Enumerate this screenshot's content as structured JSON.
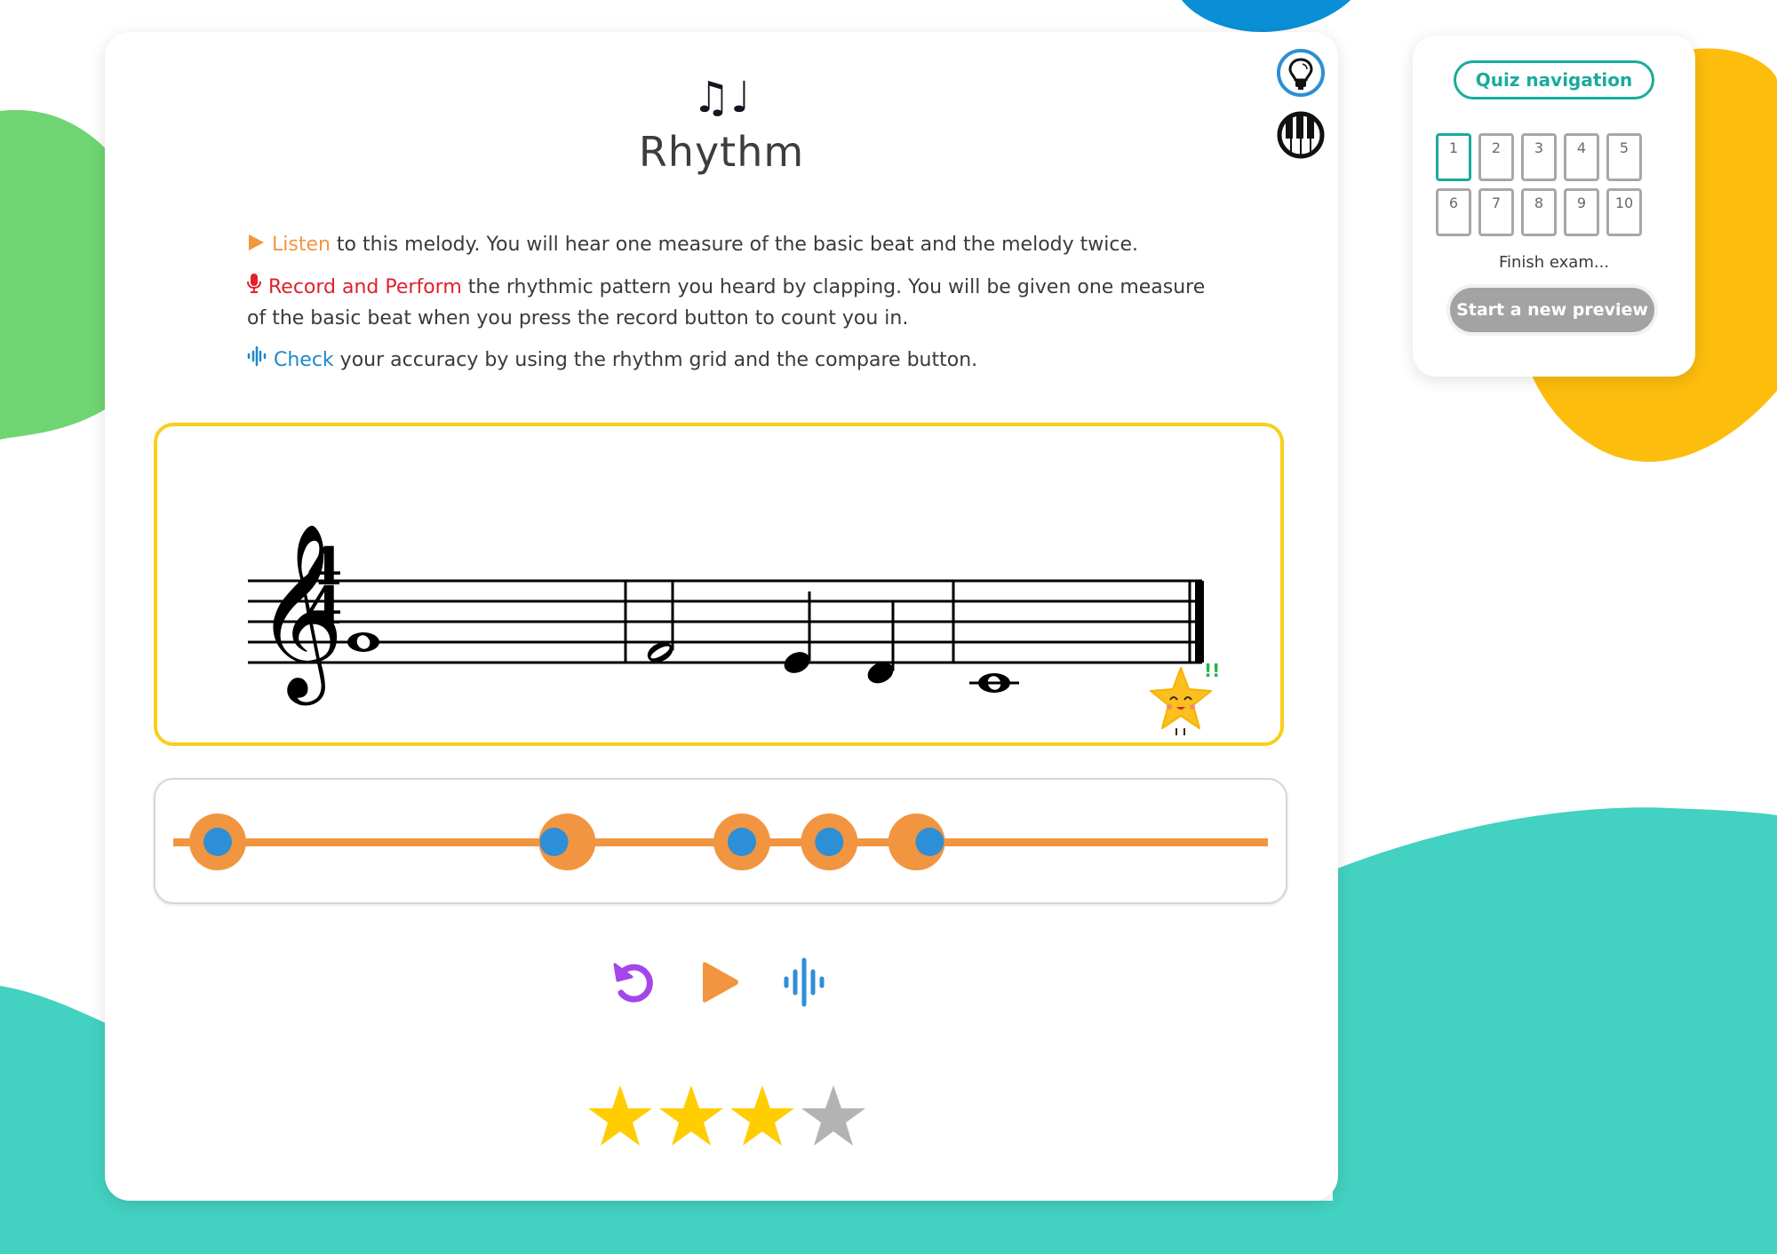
{
  "background": {
    "colors": {
      "green": "#6fd572",
      "blue": "#0a8fd6",
      "yellow": "#fdbd0d",
      "teal": "#43d1c1"
    }
  },
  "header": {
    "icon": "music-notes-icon",
    "icon_glyph": "♫♩",
    "title": "Rhythm"
  },
  "tools": [
    {
      "name": "hint",
      "icon": "lightbulb-icon"
    },
    {
      "name": "piano",
      "icon": "piano-keys-icon"
    }
  ],
  "instructions": [
    {
      "icon": "play-triangle-icon",
      "keyword": "Listen",
      "text": " to this melody. You will hear one measure of the basic beat and the melody twice."
    },
    {
      "icon": "microphone-icon",
      "keyword": "Record and Perform",
      "text": " the rhythmic pattern you heard by clapping. You will be given one measure of the basic beat when you press the record button to count you in."
    },
    {
      "icon": "soundwave-icon",
      "keyword": "Check",
      "text": " your accuracy by using the rhythm grid and the compare button."
    }
  ],
  "score": {
    "clef": "treble",
    "time_signature": "4/4",
    "measures": [
      {
        "notes": [
          {
            "pitch": "G4",
            "duration": "whole"
          }
        ]
      },
      {
        "notes": [
          {
            "pitch": "F4",
            "duration": "half"
          },
          {
            "pitch": "E4",
            "duration": "quarter"
          },
          {
            "pitch": "D4",
            "duration": "quarter"
          }
        ]
      },
      {
        "notes": [
          {
            "pitch": "C4",
            "duration": "whole"
          }
        ]
      }
    ],
    "mascot": "happy-star-icon",
    "mascot_mark": "!!"
  },
  "rhythm_grid": {
    "total_beats": 12,
    "expected_beats": [
      0,
      4,
      6,
      7,
      8
    ],
    "performed_beats": [
      0,
      3.85,
      6,
      7,
      8.15
    ]
  },
  "controls": [
    {
      "name": "restart",
      "icon": "restart-icon",
      "color": "#a446ea"
    },
    {
      "name": "play",
      "icon": "play-icon",
      "color": "#f29540"
    },
    {
      "name": "compare",
      "icon": "soundwave-icon",
      "color": "#2d8fd5"
    }
  ],
  "rating": {
    "value": 3,
    "max": 4,
    "filled_color": "#ffcd00",
    "empty_color": "#b3b3b3"
  },
  "quiz_nav": {
    "title": "Quiz navigation",
    "questions": [
      "1",
      "2",
      "3",
      "4",
      "5",
      "6",
      "7",
      "8",
      "9",
      "10"
    ],
    "current": "1",
    "finish_label": "Finish exam...",
    "preview_label": "Start a new preview"
  }
}
